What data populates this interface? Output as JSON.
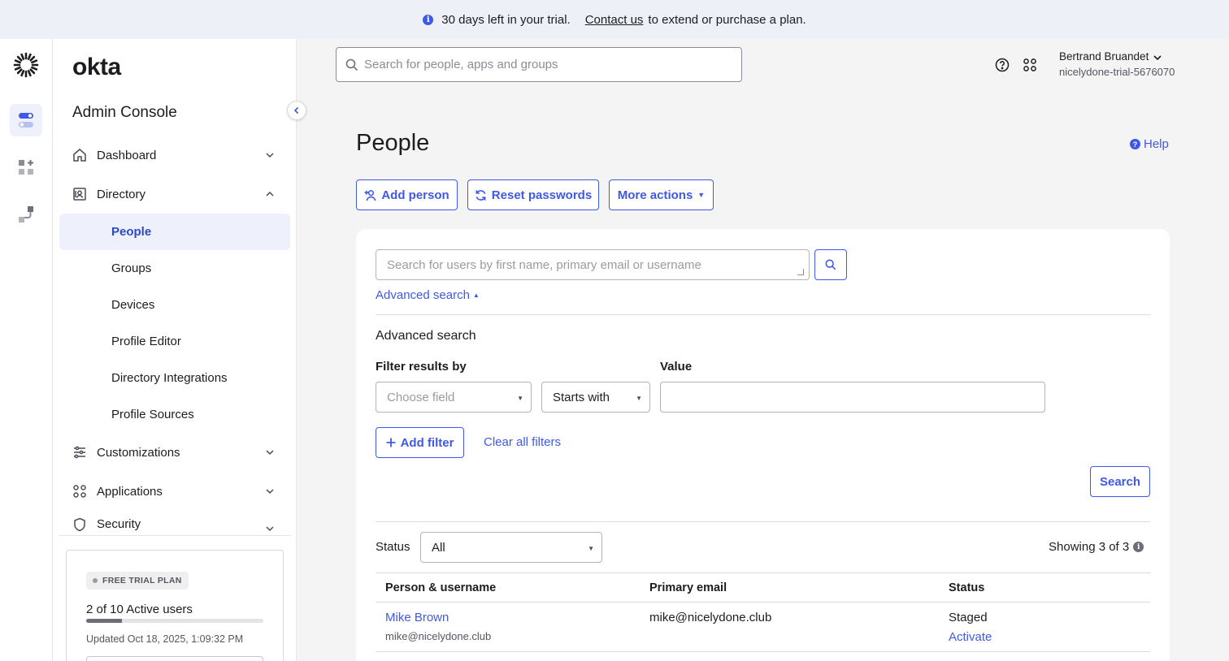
{
  "banner": {
    "message": "30 days left in your trial.",
    "link": "Contact us",
    "suffix": "to extend or purchase a plan."
  },
  "sidebar": {
    "brand": "okta",
    "console_title": "Admin Console",
    "sections": {
      "dashboard": "Dashboard",
      "directory": "Directory",
      "customizations": "Customizations",
      "applications": "Applications",
      "security": "Security"
    },
    "directory_items": [
      "People",
      "Groups",
      "Devices",
      "Profile Editor",
      "Directory Integrations",
      "Profile Sources"
    ],
    "active_item": "People",
    "trial": {
      "badge": "FREE TRIAL PLAN",
      "users": "2 of 10 Active users",
      "progress": 0.2,
      "updated": "Updated Oct 18, 2025, 1:09:32 PM"
    }
  },
  "topbar": {
    "search_placeholder": "Search for people, apps and groups",
    "user_name": "Bertrand Bruandet",
    "org": "nicelydone-trial-5676070"
  },
  "main": {
    "title": "People",
    "help": "Help",
    "actions": {
      "add_person": "Add person",
      "reset_passwords": "Reset passwords",
      "more_actions": "More actions"
    },
    "user_search_placeholder": "Search for users by first name, primary email or username",
    "advanced_toggle": "Advanced search",
    "advanced_title": "Advanced search",
    "filter_label": "Filter results by",
    "value_label": "Value",
    "field_placeholder": "Choose field",
    "operator": "Starts with",
    "add_filter": "Add filter",
    "clear_filters": "Clear all filters",
    "search_button": "Search",
    "status_label": "Status",
    "status_value": "All",
    "showing": "Showing 3 of 3",
    "columns": [
      "Person & username",
      "Primary email",
      "Status"
    ],
    "rows": [
      {
        "name": "Mike Brown",
        "username": "mike@nicelydone.club",
        "email": "mike@nicelydone.club",
        "status": "Staged",
        "action": "Activate"
      }
    ]
  },
  "colors": {
    "accent": "#3f59e4",
    "banner_bg": "#eef0f7",
    "active_nav_bg": "#eef0fb"
  }
}
